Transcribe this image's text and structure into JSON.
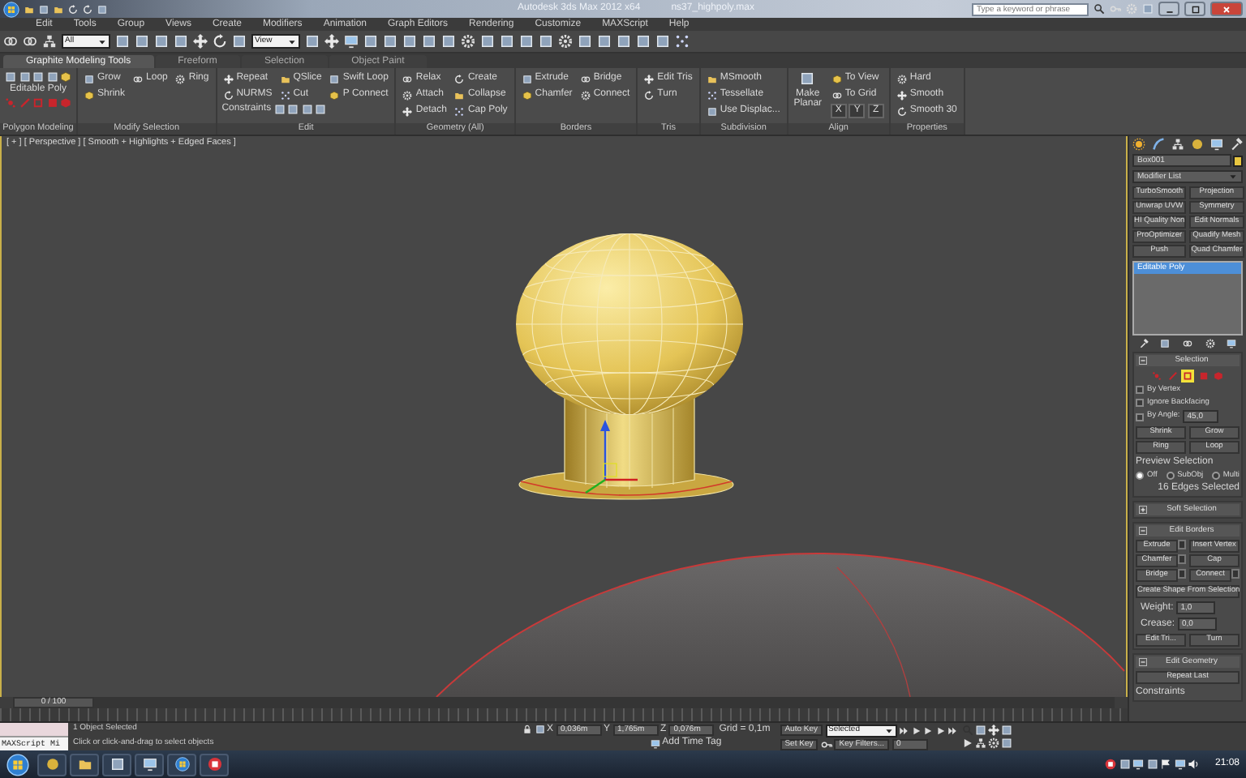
{
  "title_bar": {
    "app_title": "Autodesk 3ds Max 2012 x64",
    "file_name": "ns37_highpoly.max",
    "search": {
      "placeholder": "Type a keyword or phrase"
    }
  },
  "menu": [
    "Edit",
    "Tools",
    "Group",
    "Views",
    "Create",
    "Modifiers",
    "Animation",
    "Graph Editors",
    "Rendering",
    "Customize",
    "MAXScript",
    "Help"
  ],
  "main_toolbar": {
    "selection_filter": "All",
    "reference_coord": "View"
  },
  "ribbon": {
    "tabs": [
      {
        "label": "Graphite Modeling Tools",
        "selected": true
      },
      {
        "label": "Freeform",
        "selected": false
      },
      {
        "label": "Selection",
        "selected": false
      },
      {
        "label": "Object Paint",
        "selected": false
      }
    ],
    "groups": [
      {
        "title": "Polygon Modeling",
        "kind": "poly",
        "columns": [
          [
            "Editable Poly"
          ]
        ]
      },
      {
        "title": "Modify Selection",
        "kind": "buttons",
        "columns": [
          [
            "Grow",
            "Shrink"
          ],
          [
            "Loop"
          ],
          [
            "Ring"
          ]
        ]
      },
      {
        "title": "Edit",
        "kind": "buttons",
        "columns": [
          [
            "Repeat",
            "NURMS"
          ],
          [
            "QSlice",
            "Cut"
          ],
          [
            "Swift Loop",
            "P Connect"
          ]
        ],
        "footer": "Constraints"
      },
      {
        "title": "Geometry (All)",
        "kind": "buttons",
        "columns": [
          [
            "Relax",
            "Attach",
            "Detach"
          ],
          [
            "Create",
            "Collapse",
            "Cap Poly"
          ]
        ]
      },
      {
        "title": "Borders",
        "kind": "buttons",
        "columns": [
          [
            "Extrude",
            "Chamfer"
          ],
          [
            "Bridge",
            "Connect"
          ]
        ]
      },
      {
        "title": "Tris",
        "kind": "buttons",
        "columns": [
          [
            "Edit Tris",
            "Turn"
          ]
        ]
      },
      {
        "title": "Subdivision",
        "kind": "buttons",
        "columns": [
          [
            "MSmooth",
            "Tessellate",
            "Use Displac..."
          ]
        ]
      },
      {
        "title": "Align",
        "kind": "align",
        "columns": [
          [
            "Make Planar"
          ],
          [
            "To View",
            "To Grid"
          ]
        ],
        "axes": [
          "X",
          "Y",
          "Z"
        ]
      },
      {
        "title": "Properties",
        "kind": "buttons",
        "columns": [
          [
            "Hard",
            "Smooth",
            "Smooth 30"
          ]
        ]
      }
    ]
  },
  "viewport": {
    "label": "[ + ] [ Perspective ] [ Smooth + Highlights + Edged Faces ]"
  },
  "command_panel": {
    "object_name": "Box001",
    "modifier_list": "Modifier List",
    "modifier_buttons": [
      "TurboSmooth",
      "Projection",
      "Unwrap UVW",
      "Symmetry",
      "HI Quality Non",
      "Edit Normals",
      "ProOptimizer",
      "Quadify Mesh",
      "Push",
      "Quad Chamfer"
    ],
    "stack": [
      {
        "label": "Editable Poly",
        "selected": true
      }
    ],
    "selection": {
      "title": "Selection",
      "expanded": true,
      "subobject_levels": [
        {
          "kind": "vertex",
          "selected": false
        },
        {
          "kind": "edge",
          "selected": false
        },
        {
          "kind": "border",
          "selected": true
        },
        {
          "kind": "polygon",
          "selected": false
        },
        {
          "kind": "element",
          "selected": false
        }
      ],
      "options": [
        {
          "label": "By Vertex",
          "checked": false
        },
        {
          "label": "Ignore Backfacing",
          "checked": false
        },
        {
          "label": "By Angle:",
          "checked": false,
          "value": "45,0"
        }
      ],
      "buttons": [
        "Shrink",
        "Grow",
        "Ring",
        "Loop"
      ],
      "preview_title": "Preview Selection",
      "preview": [
        {
          "label": "Off",
          "selected": true
        },
        {
          "label": "SubObj",
          "selected": false
        },
        {
          "label": "Multi",
          "selected": false
        }
      ],
      "status": "16 Edges Selected"
    },
    "soft_selection": {
      "title": "Soft Selection",
      "expanded": false
    },
    "edit_borders": {
      "title": "Edit Borders",
      "expanded": true,
      "buttons": [
        {
          "label": "Extrude",
          "settings": true
        },
        {
          "label": "Insert Vertex",
          "settings": false
        },
        {
          "label": "Chamfer",
          "settings": true
        },
        {
          "label": "Cap",
          "settings": false
        },
        {
          "label": "Bridge",
          "settings": true
        },
        {
          "label": "Connect",
          "settings": true
        }
      ],
      "wide_button": "Create Shape From Selection",
      "fields": [
        {
          "label": "Weight:",
          "value": "1,0"
        },
        {
          "label": "Crease:",
          "value": "0,0"
        }
      ],
      "bottom_buttons": [
        "Edit Tri...",
        "Turn"
      ]
    },
    "edit_geometry": {
      "title": "Edit Geometry",
      "expanded": true,
      "button": "Repeat Last",
      "constraints_label": "Constraints"
    }
  },
  "timeline": {
    "frame": "0 / 100",
    "level": 0
  },
  "status_bar": {
    "listener": "MAXScript Mi",
    "message": "1 Object Selected",
    "prompt": "Click or click-and-drag to select objects",
    "coordinates": [
      {
        "axis": "X",
        "value": "0,036m"
      },
      {
        "axis": "Y",
        "value": "1,765m"
      },
      {
        "axis": "Z",
        "value": "0,076m"
      }
    ],
    "grid": "Grid = 0,1m",
    "time_tag": "Add Time Tag",
    "auto_key": "Auto Key",
    "key_mode": "Selected",
    "set_key": "Set Key",
    "key_filters": "Key Filters...",
    "current_frame": "0"
  },
  "taskbar": {
    "clock": "21:08"
  }
}
